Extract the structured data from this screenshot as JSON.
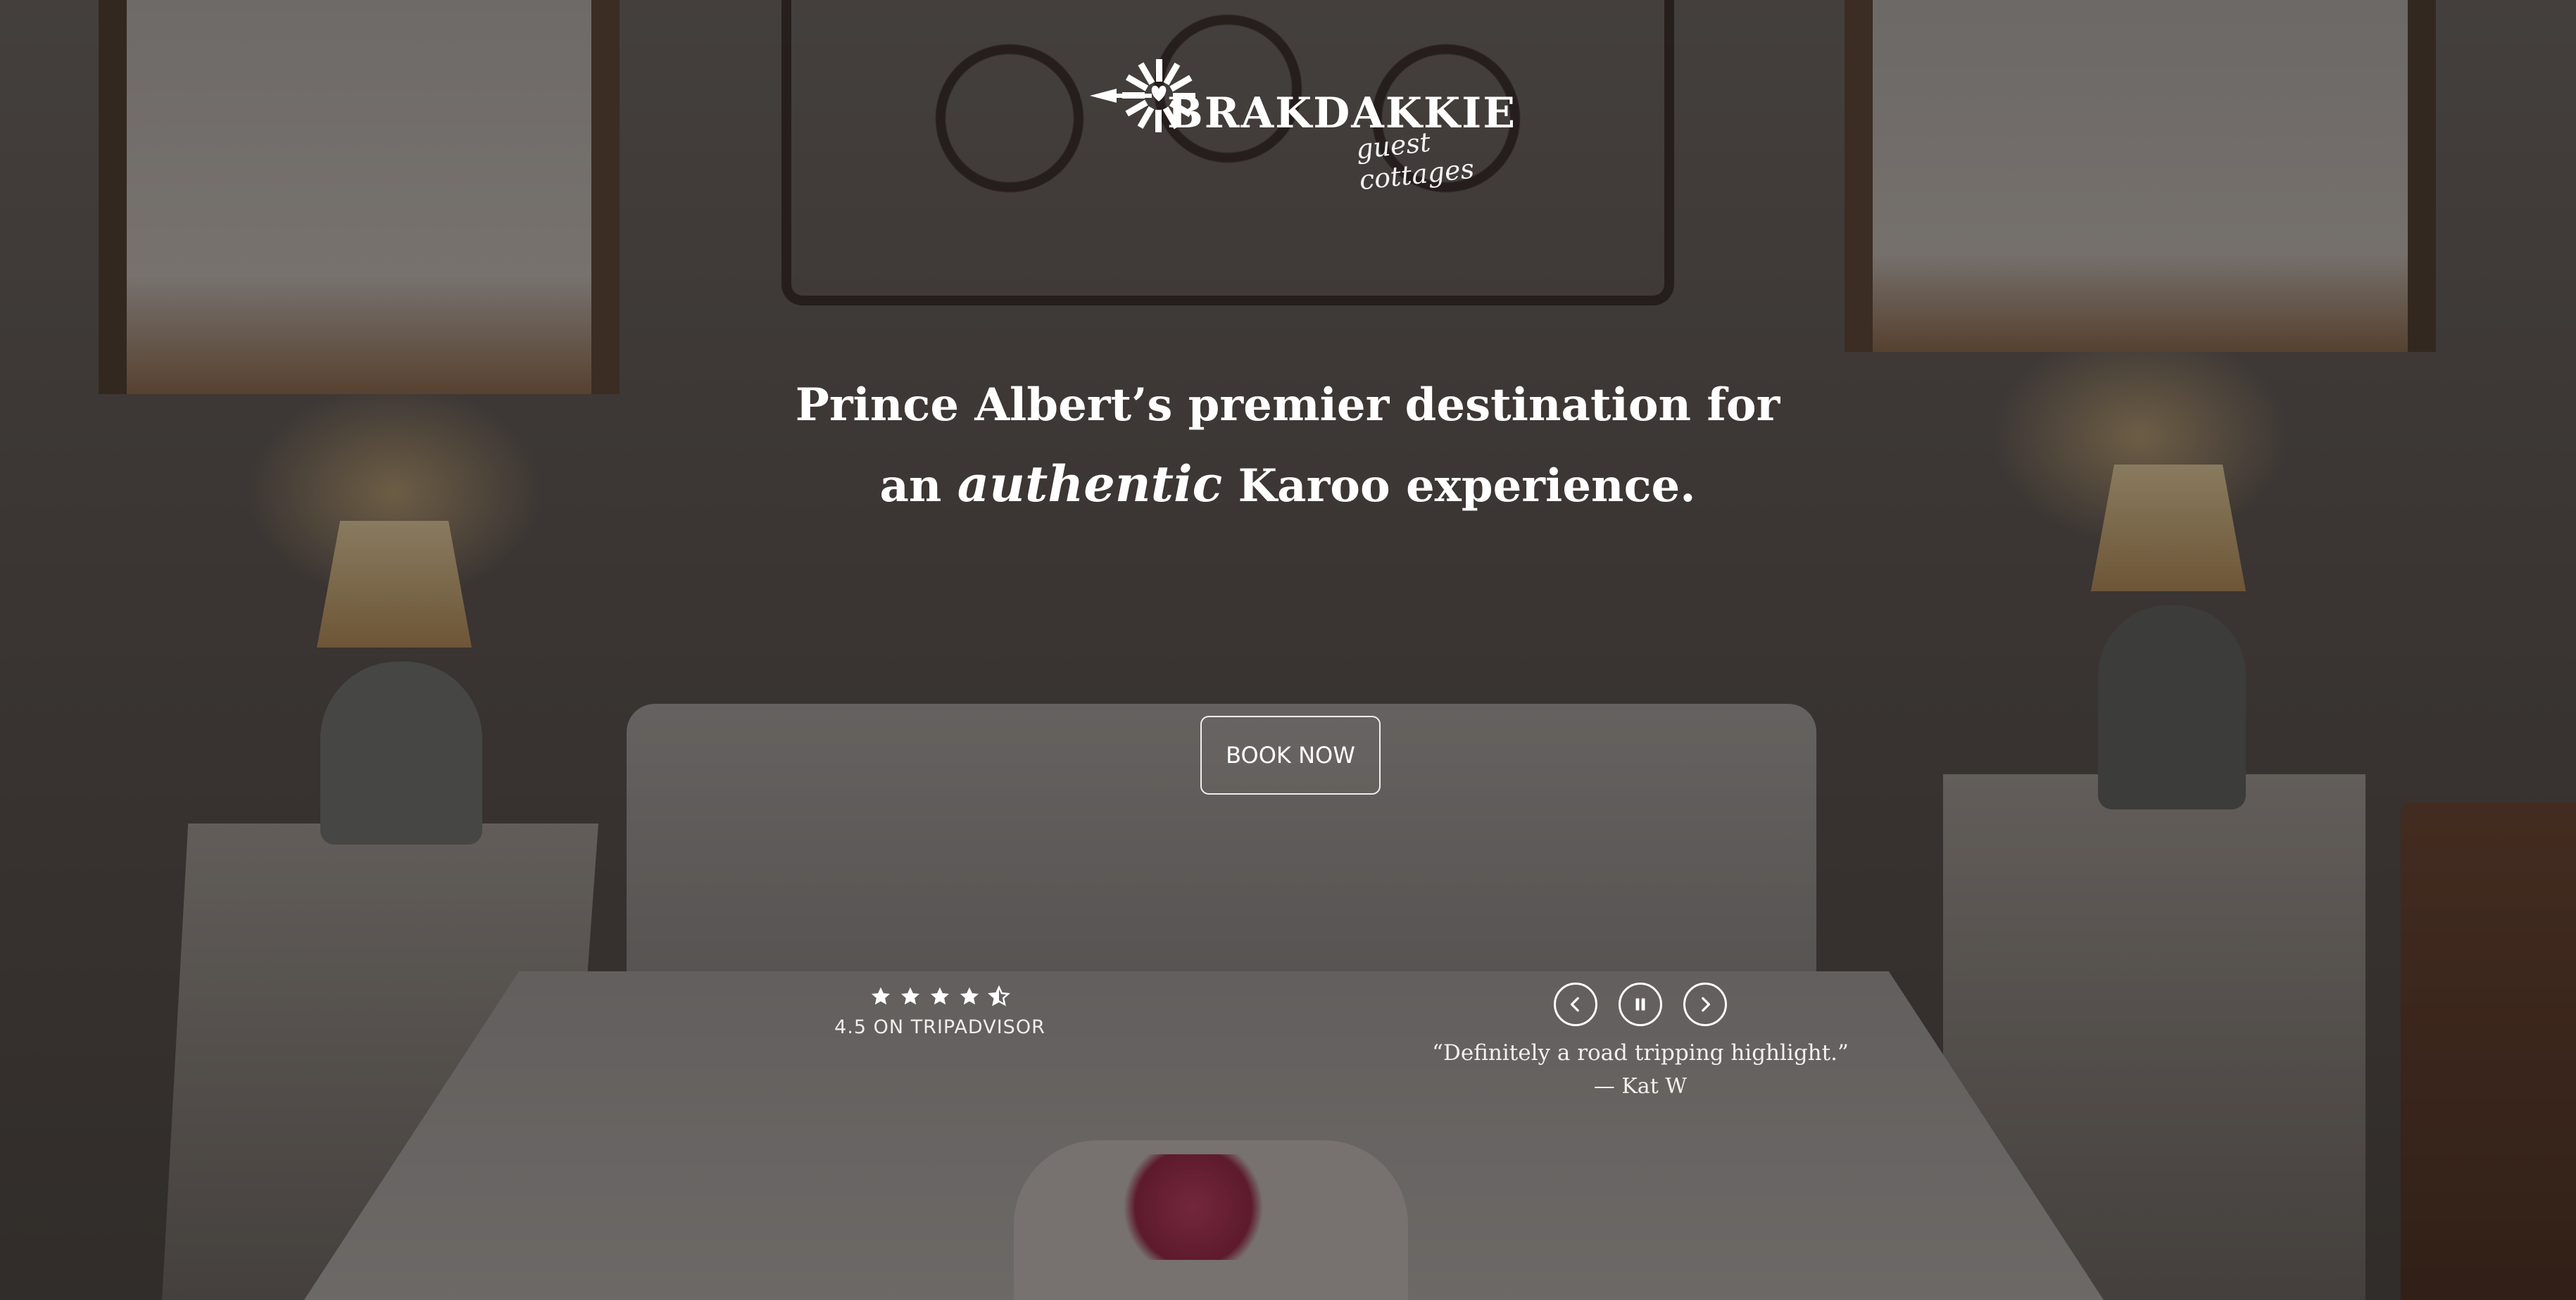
{
  "brand": {
    "name": "BRAKDAKKIE",
    "subtitle": "guest cottages",
    "logo_icon": "windmill-heart-icon"
  },
  "hero": {
    "tagline_line1": "Prince Albert’s premier destination for",
    "tagline_pre": "an",
    "tagline_accent": "authentic",
    "tagline_post": "Karoo experience.",
    "background_image": "bedroom-photo"
  },
  "cta": {
    "book_label": "BOOK NOW"
  },
  "rating": {
    "stars": 4.5,
    "max_stars": 5,
    "label": "4.5 ON TRIPADVISOR",
    "star_icon": "star-icon"
  },
  "testimonial": {
    "quote": "“Definitely a road tripping highlight.”",
    "author": "— Kat W",
    "prev_icon": "chevron-left-icon",
    "pause_icon": "pause-icon",
    "next_icon": "chevron-right-icon"
  },
  "colors": {
    "text": "#ffffff",
    "overlay": "#14100e"
  }
}
